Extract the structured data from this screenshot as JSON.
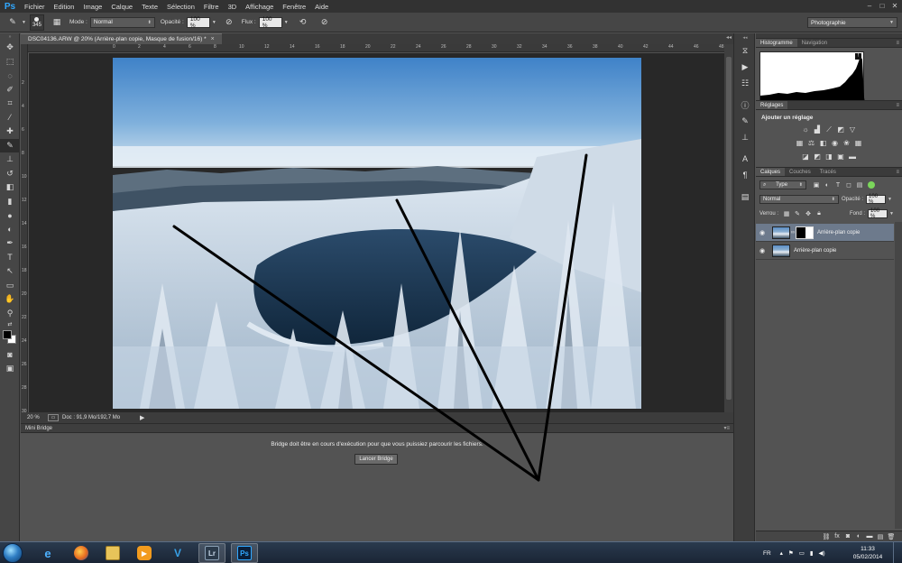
{
  "app": {
    "logo": "Ps",
    "menu": [
      "Fichier",
      "Edition",
      "Image",
      "Calque",
      "Texte",
      "Sélection",
      "Filtre",
      "3D",
      "Affichage",
      "Fenêtre",
      "Aide"
    ],
    "window_controls": [
      "–",
      "□",
      "✕"
    ]
  },
  "options": {
    "brush_size": "345",
    "mode_label": "Mode :",
    "mode_value": "Normal",
    "opacity_label": "Opacité :",
    "opacity_value": "100 %",
    "flow_label": "Flux :",
    "flow_value": "100 %",
    "workspace": "Photographie"
  },
  "document": {
    "tab_title": "DSC04136.ARW @ 20% (Arrière-plan copie, Masque de fusion/16) *",
    "close_glyph": "×",
    "zoom": "20 %",
    "doc_info": "Doc : 91,9 Mo/192,7 Mo",
    "ruler_ticks": [
      "0",
      "2",
      "4",
      "6",
      "8",
      "10",
      "12",
      "14",
      "16",
      "18",
      "20",
      "22",
      "24",
      "26",
      "28",
      "30",
      "32",
      "34",
      "36",
      "38",
      "40",
      "42",
      "44",
      "46",
      "48"
    ],
    "ruler_left_ticks": [
      "2",
      "4",
      "6",
      "8",
      "10",
      "12",
      "14",
      "16",
      "18",
      "20",
      "22",
      "24",
      "26",
      "28",
      "30"
    ]
  },
  "mini_bridge": {
    "title": "Mini Bridge",
    "message": "Bridge doit être en cours d'exécution pour que vous puissiez parcourir les fichiers.",
    "button": "Lancer Bridge"
  },
  "panels": {
    "histogram_tabs": [
      "Histogramme",
      "Navigation"
    ],
    "adjust_tab": "Réglages",
    "adjust_title": "Ajouter un réglage",
    "layers_tabs": [
      "Calques",
      "Couches",
      "Tracés"
    ],
    "filter_type": "Type",
    "blend_mode": "Normal",
    "opacity_label": "Opacité :",
    "opacity_value": "100 %",
    "lock_label": "Verrou :",
    "fill_label": "Fond :",
    "fill_value": "100 %",
    "layers": [
      {
        "name": "Arrière-plan copie",
        "selected": true,
        "has_mask": true
      },
      {
        "name": "Arrière-plan copie",
        "selected": false,
        "has_mask": false
      }
    ]
  },
  "taskbar": {
    "lang": "FR",
    "time": "11:33",
    "date": "05/02/2014",
    "apps": [
      {
        "name": "internet-explorer",
        "label": "e",
        "color": "#2b8be0"
      },
      {
        "name": "firefox",
        "label": "",
        "color": "#e66a1f"
      },
      {
        "name": "explorer",
        "label": "",
        "color": "#e8c45a"
      },
      {
        "name": "media-player",
        "label": "▶",
        "color": "#f29b1d"
      },
      {
        "name": "app-v",
        "label": "V",
        "color": "#37a0e6"
      },
      {
        "name": "lightroom",
        "label": "Lr",
        "color": "#2b3a4a"
      },
      {
        "name": "photoshop",
        "label": "Ps",
        "color": "#0a1f3a"
      }
    ]
  },
  "colors": {
    "accent": "#31a8ff",
    "panel": "#535353",
    "dark": "#323232"
  }
}
